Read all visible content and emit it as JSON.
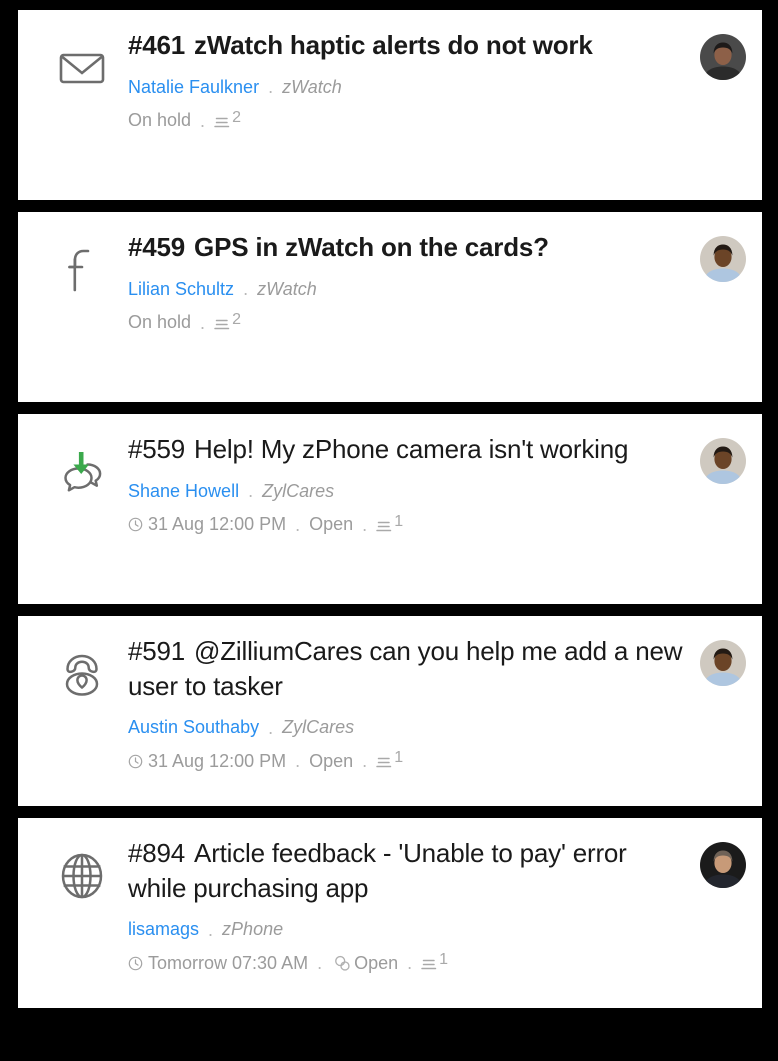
{
  "list": {
    "name": "ticket-list",
    "tickets": [
      {
        "channel_icon": "email-icon",
        "id": "#461",
        "subject": "zWatch haptic alerts do not work",
        "unread": true,
        "requester": "Natalie Faulkner",
        "brand": "zWatch",
        "due_date": "",
        "has_clock": false,
        "has_merge": false,
        "status": "On hold",
        "thread_count": "2",
        "avatar": "avatar-natalie-faulkner"
      },
      {
        "channel_icon": "facebook-icon",
        "id": "#459",
        "subject": "GPS in zWatch on the cards?",
        "unread": true,
        "requester": "Lilian Schultz",
        "brand": "zWatch",
        "due_date": "",
        "has_clock": false,
        "has_merge": false,
        "status": "On hold",
        "thread_count": "2",
        "avatar": "avatar-lilian-schultz"
      },
      {
        "channel_icon": "live-chat-icon",
        "id": "#559",
        "subject": "Help! My zPhone camera isn't working",
        "unread": false,
        "requester": "Shane Howell",
        "brand": "ZylCares",
        "due_date": "31 Aug 12:00 PM",
        "has_clock": true,
        "has_merge": false,
        "status": "Open",
        "thread_count": "1",
        "avatar": "avatar-shane-howell"
      },
      {
        "channel_icon": "phone-icon",
        "id": "#591",
        "subject": "@ZilliumCares can you help me add a new user to tasker",
        "unread": false,
        "requester": "Austin Southaby",
        "brand": "ZylCares",
        "due_date": "31 Aug 12:00 PM",
        "has_clock": true,
        "has_merge": false,
        "status": "Open",
        "thread_count": "1",
        "avatar": "avatar-austin-southaby"
      },
      {
        "channel_icon": "web-globe-icon",
        "id": "#894",
        "subject": "Article feedback - 'Unable to pay' error while purchasing app",
        "unread": false,
        "requester": "lisamags",
        "brand": "zPhone",
        "due_date": "Tomorrow 07:30 AM",
        "has_clock": true,
        "has_merge": true,
        "status": "Open",
        "thread_count": "1",
        "avatar": "avatar-lisamags"
      }
    ],
    "separator": "."
  },
  "colors": {
    "link": "#2a8ff0",
    "muted": "#9b9b9b",
    "title": "#1a1a1a",
    "icon": "#6d6d6d",
    "chat_arrow": "#3ba94c",
    "page_background": "#000000",
    "card_background": "#ffffff"
  }
}
